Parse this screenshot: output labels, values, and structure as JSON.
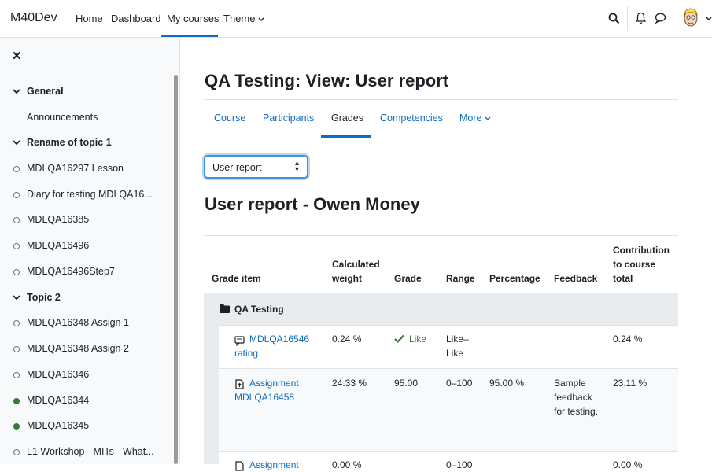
{
  "header": {
    "brand": "M40Dev",
    "nav": [
      "Home",
      "Dashboard",
      "My courses",
      "Theme"
    ],
    "active_nav": "My courses",
    "icons": [
      "search-icon",
      "bell-icon",
      "chat-icon",
      "avatar"
    ]
  },
  "drawer": {
    "close_icon": "close-icon",
    "sections": [
      {
        "name": "General",
        "items": [
          {
            "label": "Announcements",
            "status": "none"
          }
        ]
      },
      {
        "name": "Rename of topic 1",
        "items": [
          {
            "label": "MDLQA16297 Lesson",
            "status": "open"
          },
          {
            "label": "Diary for testing MDLQA16...",
            "status": "open"
          },
          {
            "label": "MDLQA16385",
            "status": "open"
          },
          {
            "label": "MDLQA16496",
            "status": "open"
          },
          {
            "label": "MDLQA16496Step7",
            "status": "open"
          }
        ]
      },
      {
        "name": "Topic 2",
        "items": [
          {
            "label": "MDLQA16348 Assign 1",
            "status": "open"
          },
          {
            "label": "MDLQA16348 Assign 2",
            "status": "open"
          },
          {
            "label": "MDLQA16346",
            "status": "open"
          },
          {
            "label": "MDLQA16344",
            "status": "done"
          },
          {
            "label": "MDLQA16345",
            "status": "done"
          },
          {
            "label": "L1 Workshop - MITs - What...",
            "status": "open"
          }
        ]
      }
    ]
  },
  "page": {
    "title": "QA Testing: View: User report",
    "tabs": [
      "Course",
      "Participants",
      "Grades",
      "Competencies",
      "More"
    ],
    "active_tab": "Grades",
    "report_select": "User report",
    "report_heading": "User report - Owen Money"
  },
  "table": {
    "headers": {
      "grade_item": "Grade item",
      "calculated_weight": "Calculated weight",
      "grade": "Grade",
      "range": "Range",
      "percentage": "Percentage",
      "feedback": "Feedback",
      "contribution": "Contribution to course total"
    },
    "category": "QA Testing",
    "rows": [
      {
        "item": "MDLQA16546 rating",
        "weight": "0.24 %",
        "grade": "Like",
        "range": "Like–Like",
        "percentage": "",
        "feedback": "",
        "contribution": "0.24 %"
      },
      {
        "item": "Assignment MDLQA16458",
        "weight": "24.33 %",
        "grade": "95.00",
        "range": "0–100",
        "percentage": "95.00 %",
        "feedback": "Sample feedback for testing.",
        "contribution": "23.11 %"
      },
      {
        "item": "Assignment",
        "weight": "0.00 %",
        "grade": "",
        "range": "0–100",
        "percentage": "",
        "feedback": "",
        "contribution": "0.00 %"
      }
    ]
  }
}
